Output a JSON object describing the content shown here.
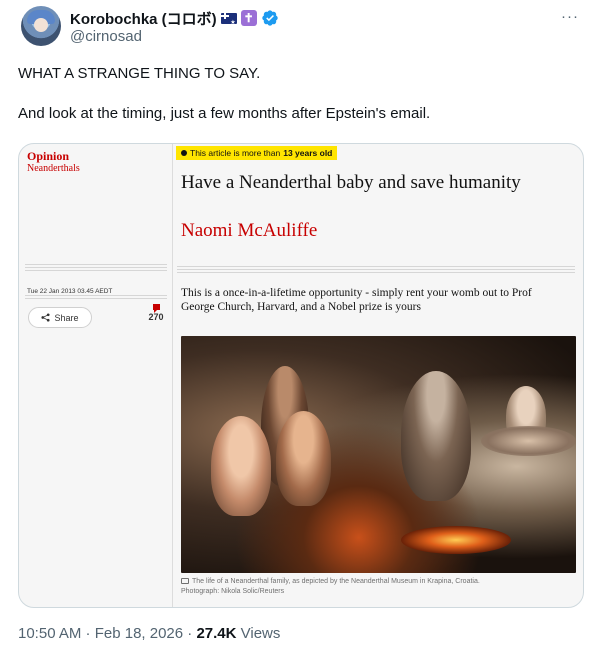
{
  "author": {
    "display_name": "Korobochka (コロボ)",
    "handle": "@cirnosad",
    "badges": [
      "australia-flag-icon",
      "latin-cross-icon",
      "verified-badge-icon"
    ],
    "verified_color": "#1d9bf0"
  },
  "more_label": "···",
  "tweet": {
    "line1": "WHAT A STRANGE THING TO SAY.",
    "line2": "And look at the timing, just a few months after Epstein's email."
  },
  "article": {
    "section_label": "Opinion",
    "section_sub": "Neanderthals",
    "age_badge_prefix": "This article is more than ",
    "age_badge_bold": "13 years old",
    "headline": "Have a Neanderthal baby and save humanity",
    "byline": "Naomi McAuliffe",
    "date": "Tue 22 Jan 2013 03.45 AEDT",
    "share_label": "Share",
    "comment_count": "270",
    "standfirst": "This is a once-in-a-lifetime opportunity - simply rent your womb out to Prof George Church, Harvard, and a Nobel prize is yours",
    "caption_line1": "The life of a Neanderthal family, as depicted by the Neanderthal Museum in Krapina, Croatia.",
    "caption_line2": "Photograph: Nikola Solic/Reuters",
    "accent_color": "#c70000",
    "badge_color": "#ffe500"
  },
  "meta": {
    "time_date": "10:50 AM · Feb 18, 2026 · ",
    "views_count": "27.4K",
    "views_label": " Views"
  }
}
